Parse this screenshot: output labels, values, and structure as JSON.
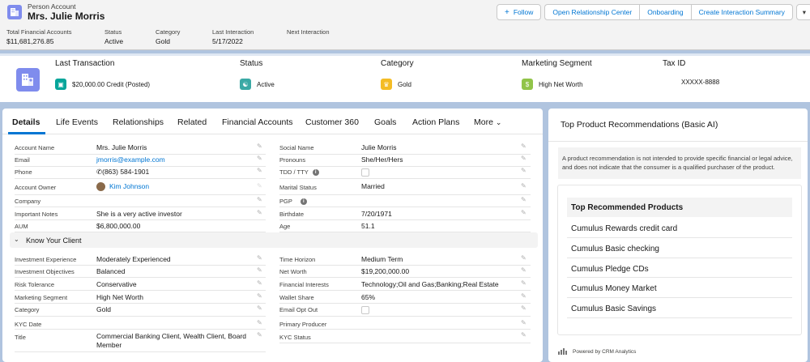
{
  "header": {
    "record_type": "Person Account",
    "record_name": "Mrs. Julie Morris",
    "buttons": {
      "follow": "Follow",
      "open_relationship_center": "Open Relationship Center",
      "onboarding": "Onboarding",
      "create_interaction_summary": "Create Interaction Summary"
    },
    "highlights": [
      {
        "label": "Total Financial Accounts",
        "value": "$11,681,276.85"
      },
      {
        "label": "Status",
        "value": "Active"
      },
      {
        "label": "Category",
        "value": "Gold"
      },
      {
        "label": "Last Interaction",
        "value": "5/17/2022"
      },
      {
        "label": "Next Interaction",
        "value": ""
      }
    ]
  },
  "summary": {
    "last_transaction": {
      "label": "Last Transaction",
      "value": "$20,000.00 Credit (Posted)"
    },
    "status": {
      "label": "Status",
      "value": "Active"
    },
    "category": {
      "label": "Category",
      "value": "Gold"
    },
    "marketing_segment": {
      "label": "Marketing Segment",
      "value": "High Net Worth"
    },
    "tax_id": {
      "label": "Tax ID",
      "value": "XXXXX-8888"
    }
  },
  "tabs": [
    "Details",
    "Life Events",
    "Relationships",
    "Related",
    "Financial Accounts",
    "Customer 360",
    "Goals",
    "Action Plans",
    "More"
  ],
  "details": {
    "left": [
      {
        "label": "Account Name",
        "value": "Mrs. Julie Morris"
      },
      {
        "label": "Email",
        "value": "jmorris@example.com"
      },
      {
        "label": "Phone",
        "value": "(863) 584-1901"
      },
      {
        "label": "Account Owner",
        "value": "Kim Johnson"
      },
      {
        "label": "Company",
        "value": ""
      },
      {
        "label": "Important Notes",
        "value": "She is a very active investor"
      },
      {
        "label": "AUM",
        "value": "$6,800,000.00"
      }
    ],
    "right": [
      {
        "label": "Social Name",
        "value": "Julie Morris"
      },
      {
        "label": "Pronouns",
        "value": "She/Her/Hers"
      },
      {
        "label": "TDD / TTY",
        "value": ""
      },
      {
        "label": "Marital Status",
        "value": "Married"
      },
      {
        "label": "PGP",
        "value": ""
      },
      {
        "label": "Birthdate",
        "value": "7/20/1971"
      },
      {
        "label": "Age",
        "value": "51.1"
      }
    ]
  },
  "kyc": {
    "section_title": "Know Your Client",
    "left": [
      {
        "label": "Investment Experience",
        "value": "Moderately Experienced"
      },
      {
        "label": "Investment Objectives",
        "value": "Balanced"
      },
      {
        "label": "Risk Tolerance",
        "value": "Conservative"
      },
      {
        "label": "Marketing Segment",
        "value": "High Net Worth"
      },
      {
        "label": "Category",
        "value": "Gold"
      },
      {
        "label": "KYC Date",
        "value": ""
      },
      {
        "label": "Title",
        "value": "Commercial Banking Client, Wealth Client, Board",
        "value2": "Member"
      }
    ],
    "right": [
      {
        "label": "Time Horizon",
        "value": "Medium Term"
      },
      {
        "label": "Net Worth",
        "value": "$19,200,000.00"
      },
      {
        "label": "Financial Interests",
        "value": "Technology;Oil and Gas;Banking;Real Estate"
      },
      {
        "label": "Wallet Share",
        "value": "65%"
      },
      {
        "label": "Email Opt Out",
        "value": ""
      },
      {
        "label": "Primary Producer",
        "value": ""
      },
      {
        "label": "KYC Status",
        "value": ""
      }
    ]
  },
  "recommendations": {
    "title": "Top Product Recommendations (Basic AI)",
    "disclaimer": "A product recommendation is not intended to provide specific financial or legal advice, and does not indicate that the consumer is a qualified purchaser of the product.",
    "list_title": "Top Recommended Products",
    "items": [
      "Cumulus Rewards credit card",
      "Cumulus Basic checking",
      "Cumulus Pledge CDs",
      "Cumulus Money Market",
      "Cumulus Basic Savings"
    ],
    "powered_by": "Powered by CRM Analytics"
  },
  "colors": {
    "brand": "#0176d3",
    "record_icon": "#7f8ced",
    "background": "#b0c4df"
  }
}
